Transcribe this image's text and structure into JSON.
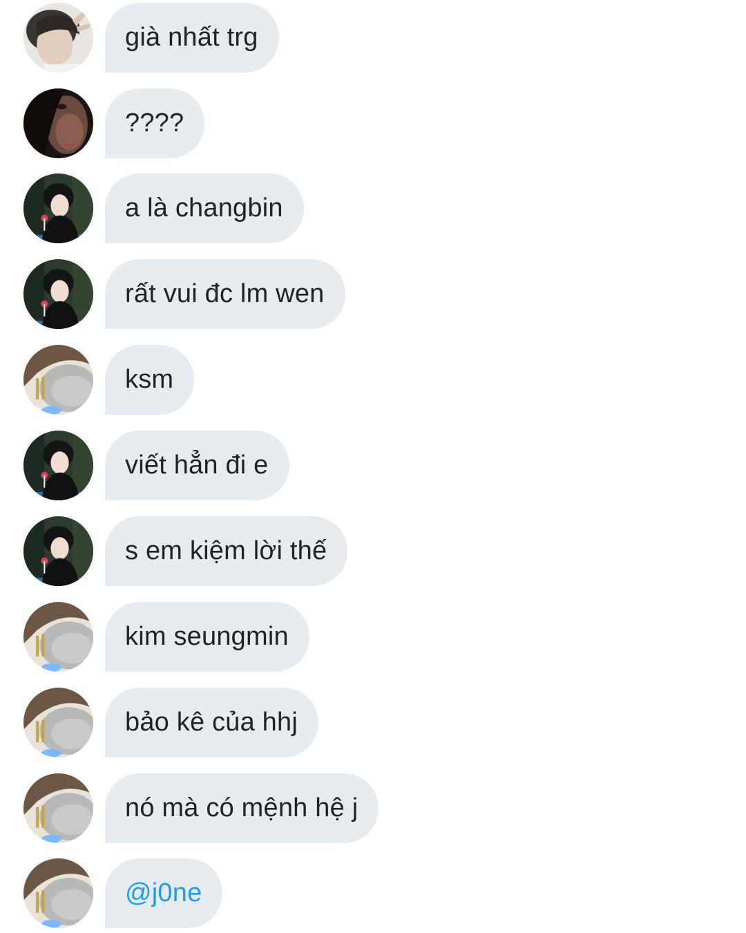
{
  "messages": [
    {
      "avatar": "avatar-user-a",
      "text": "già nhất trg"
    },
    {
      "avatar": "avatar-user-b",
      "text": "????"
    },
    {
      "avatar": "avatar-user-c",
      "text": "a là changbin"
    },
    {
      "avatar": "avatar-user-c",
      "text": "rất vui đc lm wen"
    },
    {
      "avatar": "avatar-user-d",
      "text": "ksm"
    },
    {
      "avatar": "avatar-user-c",
      "text": "viết hẳn đi e"
    },
    {
      "avatar": "avatar-user-c",
      "text": "s em kiệm lời thế"
    },
    {
      "avatar": "avatar-user-d",
      "text": "kim seungmin"
    },
    {
      "avatar": "avatar-user-d",
      "text": "bảo kê của hhj"
    },
    {
      "avatar": "avatar-user-d",
      "text": "nó mà có mệnh hệ j"
    },
    {
      "avatar": "avatar-user-d",
      "text": "@j0ne"
    }
  ],
  "colors": {
    "bubble_bg": "#e6ebf0",
    "text": "#1f2328",
    "mention": "#1d9bf0",
    "background": "#ffffff"
  }
}
